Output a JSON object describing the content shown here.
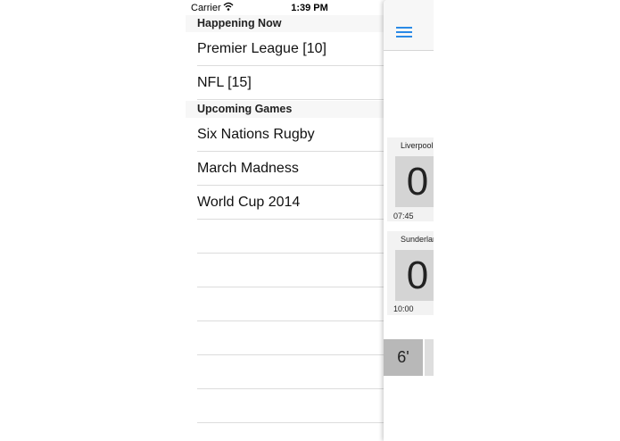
{
  "status_bar": {
    "carrier": "Carrier",
    "time": "1:39 PM"
  },
  "menu": {
    "sections": [
      {
        "header": "Happening Now",
        "items": [
          "Premier League [10]",
          "NFL [15]"
        ]
      },
      {
        "header": "Upcoming Games",
        "items": [
          "Six Nations Rugby",
          "March Madness",
          "World Cup 2014"
        ]
      }
    ]
  },
  "panel": {
    "matches": [
      {
        "team": "Liverpool",
        "score": "0",
        "time": "07:45"
      },
      {
        "team": "Sunderland",
        "score": "0",
        "time": "10:00"
      }
    ],
    "minute": "6'"
  },
  "colors": {
    "accent": "#2b8ae6",
    "header_bg": "#f7f7f7",
    "score_bg": "#d4d4d4"
  }
}
